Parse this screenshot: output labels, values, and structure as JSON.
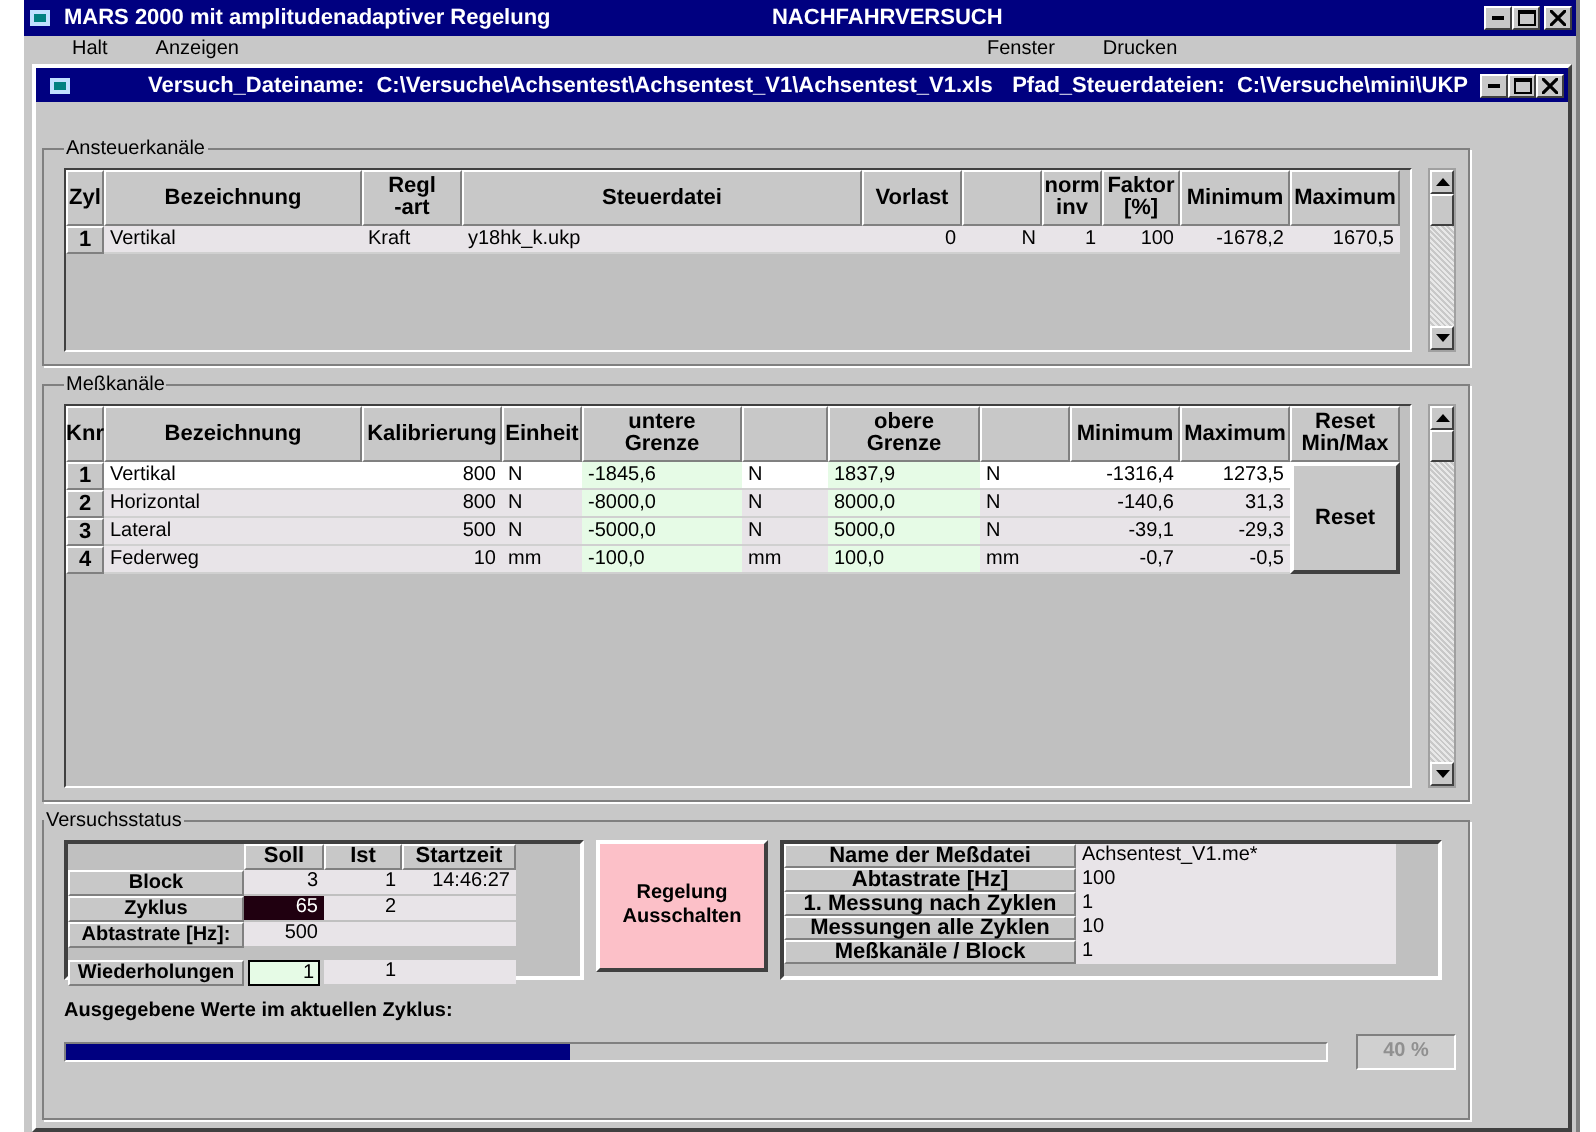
{
  "window": {
    "title": "MARS 2000  mit amplitudenadaptiver Regelung",
    "center_title": "NACHFAHRVERSUCH"
  },
  "menu_left": [
    "Halt",
    "Anzeigen"
  ],
  "menu_right": [
    "Fenster",
    "Drucken"
  ],
  "document": {
    "file_label": "Versuch_Dateiname:",
    "file_path": "C:\\Versuche\\Achsentest\\Achsentest_V1\\Achsentest_V1.xls",
    "dir_label": "Pfad_Steuerdateien:",
    "dir_path": "C:\\Versuche\\mini\\UKP"
  },
  "control_channels": {
    "title": "Ansteuerkanäle",
    "columns": [
      "Zyl",
      "Bezeichnung",
      "Regl\n-art",
      "Steuerdatei",
      "Vorlast",
      "",
      "norm\ninv",
      "Faktor\n[%]",
      "Minimum",
      "Maximum"
    ],
    "rows": [
      {
        "cells": [
          "1",
          "Vertikal",
          "Kraft",
          "y18hk_k.ukp",
          "0",
          "N",
          "1",
          "100",
          "-1678,2",
          "1670,5"
        ]
      }
    ]
  },
  "measure_channels": {
    "title": "Meßkanäle",
    "columns": [
      "Knr",
      "Bezeichnung",
      "Kalibrierung",
      "Einheit",
      "untere\nGrenze",
      "",
      "obere\nGrenze",
      "",
      "Minimum",
      "Maximum",
      "Reset\nMin/Max"
    ],
    "reset_button": "Reset",
    "rows": [
      {
        "selected": true,
        "cells": [
          "1",
          "Vertikal",
          "800",
          "N",
          "-1845,6",
          "N",
          "1837,9",
          "N",
          "-1316,4",
          "1273,5"
        ]
      },
      {
        "selected": false,
        "cells": [
          "2",
          "Horizontal",
          "800",
          "N",
          "-8000,0",
          "N",
          "8000,0",
          "N",
          "-140,6",
          "31,3"
        ]
      },
      {
        "selected": false,
        "cells": [
          "3",
          "Lateral",
          "500",
          "N",
          "-5000,0",
          "N",
          "5000,0",
          "N",
          "-39,1",
          "-29,3"
        ]
      },
      {
        "selected": false,
        "cells": [
          "4",
          "Federweg",
          "10",
          "mm",
          "-100,0",
          "mm",
          "100,0",
          "mm",
          "-0,7",
          "-0,5"
        ]
      }
    ]
  },
  "status": {
    "title": "Versuchsstatus",
    "columns": [
      "Soll",
      "Ist",
      "Startzeit"
    ],
    "rows": [
      {
        "kind": "text",
        "label": "Block",
        "soll": "3",
        "ist": "1",
        "start": "14:46:27",
        "selected": false
      },
      {
        "kind": "text",
        "label": "Zyklus",
        "soll": "65",
        "ist": "2",
        "selected": true
      },
      {
        "kind": "text",
        "label": "Abtastrate [Hz]:",
        "soll": "500",
        "selected": false
      },
      {
        "kind": "input",
        "label": "Wiederholungen",
        "soll": "1",
        "ist": "1",
        "selected": false
      }
    ],
    "button": "Regelung\nAusschalten",
    "info": [
      {
        "label": "Name der Meßdatei",
        "value": "Achsentest_V1.me*"
      },
      {
        "label": "Abtastrate [Hz]",
        "value": "100"
      },
      {
        "label": "1. Messung nach Zyklen",
        "value": "1"
      },
      {
        "label": "Messungen alle Zyklen",
        "value": "10"
      },
      {
        "label": "Meßkanäle / Block",
        "value": "1"
      }
    ],
    "progress": {
      "label": "Ausgegebene Werte im aktuellen Zyklus:",
      "level": 0.4,
      "reading": "40 %"
    }
  }
}
